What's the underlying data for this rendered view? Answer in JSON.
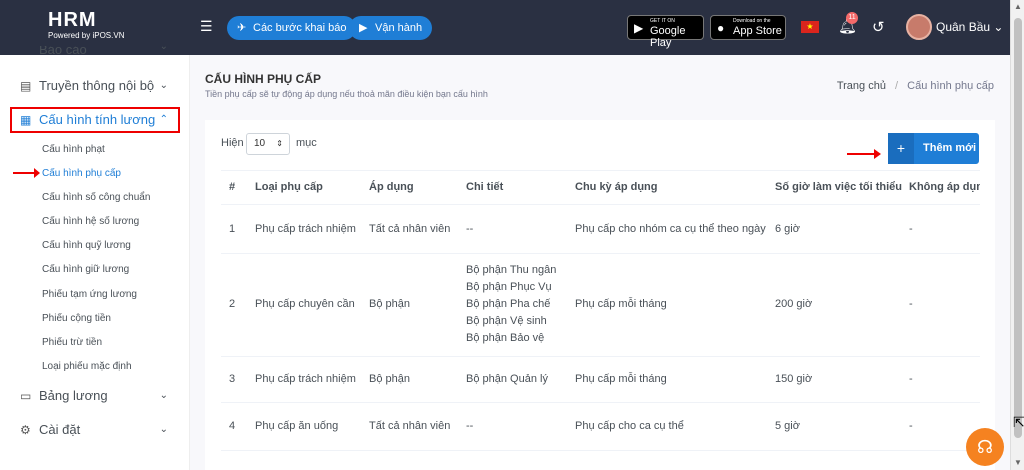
{
  "header": {
    "logo_title": "HRM",
    "logo_sub": "Powered by iPOS.VN",
    "btn_steps": "Các bước khai báo",
    "btn_operate": "Vận hành",
    "google_small": "GET IT ON",
    "google_big": "Google Play",
    "apple_small": "Download on the",
    "apple_big": "App Store",
    "notif_count": "11",
    "user_name": "Quân Bầu"
  },
  "sidebar": {
    "items": [
      {
        "label": "Báo cáo",
        "icon": "report-icon"
      },
      {
        "label": "Truyền thông nội bộ",
        "icon": "newspaper-icon"
      },
      {
        "label": "Cấu hình tính lương",
        "icon": "calculator-icon"
      },
      {
        "label": "Bảng lương",
        "icon": "money-icon"
      },
      {
        "label": "Cài đặt",
        "icon": "gear-icon"
      }
    ],
    "subitems": [
      "Cấu hình phạt",
      "Cấu hình phụ cấp",
      "Cấu hình số công chuẩn",
      "Cấu hình hệ số lương",
      "Cấu hình quỹ lương",
      "Cấu hình giữ lương",
      "Phiếu tạm ứng lương",
      "Phiếu cộng tiền",
      "Phiếu trừ tiền",
      "Loại phiếu mặc định"
    ]
  },
  "page": {
    "title": "CẤU HÌNH PHỤ CẤP",
    "subtitle": "Tiền phụ cấp sẽ tự động áp dụng nếu thoả mãn điều kiện bạn cấu hình",
    "breadcrumb_home": "Trang chủ",
    "breadcrumb_sep": "/",
    "breadcrumb_current": "Cấu hình phụ cấp",
    "show_label": "Hiện",
    "page_size": "10",
    "entries_label": "mục",
    "add_label": "Thêm mới"
  },
  "table": {
    "columns": [
      "#",
      "Loại phụ cấp",
      "Áp dụng",
      "Chi tiết",
      "Chu kỳ áp dụng",
      "Số giờ làm việc tối thiểu",
      "Không áp dụng"
    ],
    "rows": [
      {
        "no": "1",
        "type": "Phụ cấp trách nhiệm",
        "apply": "Tất cả nhân viên",
        "detail": [
          "--"
        ],
        "cycle": "Phụ cấp cho nhóm ca cụ thể theo ngày",
        "hours": "6 giờ",
        "excl": "-"
      },
      {
        "no": "2",
        "type": "Phụ cấp chuyên cần",
        "apply": "Bộ phận",
        "detail": [
          "Bộ phận Thu ngân",
          "Bộ phận Phục Vụ",
          "Bộ phận Pha chế",
          "Bộ phận Vệ sinh",
          "Bộ phận Bảo vệ"
        ],
        "cycle": "Phụ cấp mỗi tháng",
        "hours": "200 giờ",
        "excl": "-"
      },
      {
        "no": "3",
        "type": "Phụ cấp trách nhiệm",
        "apply": "Bộ phận",
        "detail": [
          "Bộ phận Quản lý"
        ],
        "cycle": "Phụ cấp mỗi tháng",
        "hours": "150 giờ",
        "excl": "-"
      },
      {
        "no": "4",
        "type": "Phụ cấp ăn uống",
        "apply": "Tất cả nhân viên",
        "detail": [
          "--"
        ],
        "cycle": "Phụ cấp cho ca cụ thể",
        "hours": "5 giờ",
        "excl": "-"
      }
    ]
  }
}
